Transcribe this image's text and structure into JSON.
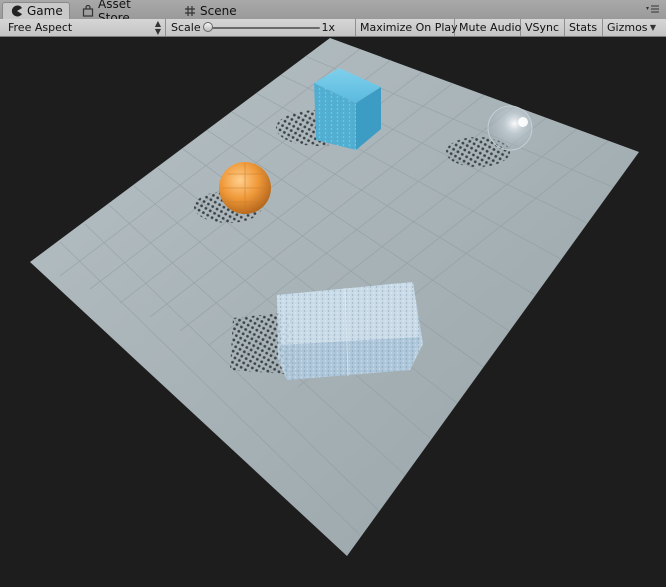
{
  "tabs": [
    {
      "label": "Game",
      "icon": "pacman-icon",
      "active": true
    },
    {
      "label": "Asset Store",
      "icon": "store-bag-icon",
      "active": false
    },
    {
      "label": "Scene",
      "icon": "grid-hash-icon",
      "active": false
    }
  ],
  "panel_menu_icon": "panel-menu-icon",
  "toolbar": {
    "aspect_label": "Free Aspect",
    "scale_label": "Scale",
    "scale_value": "1x",
    "scale_fraction": 0.0,
    "maximize_label": "Maximize On Play",
    "mute_label": "Mute Audio",
    "vsync_label": "VSync",
    "stats_label": "Stats",
    "gizmos_label": "Gizmos"
  },
  "scene": {
    "background_color": "#1d1d1d",
    "floor_color": "#a5b0b5",
    "objects": [
      {
        "name": "cube",
        "color": "#4fb4d6"
      },
      {
        "name": "orange-sphere",
        "color": "#e8902e"
      },
      {
        "name": "glass-sphere",
        "color": "#d8e2ea"
      },
      {
        "name": "glass-box",
        "color": "#b9d4ea"
      }
    ]
  }
}
